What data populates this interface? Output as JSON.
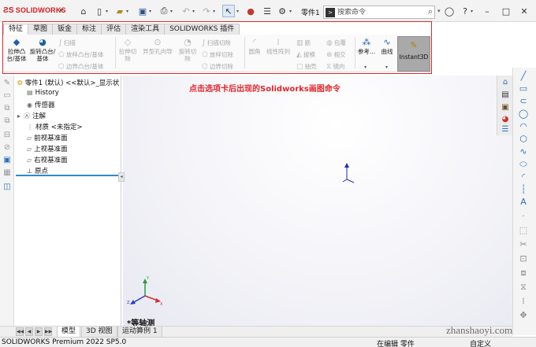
{
  "titlebar": {
    "logo_ds": "ƧS",
    "logo_text": "SOLIDWORKS",
    "part_name": "零件1",
    "search": {
      "term_icon": ">",
      "placeholder": "搜索命令"
    }
  },
  "tabs": [
    {
      "label": "特征",
      "active": true
    },
    {
      "label": "草图"
    },
    {
      "label": "钣金"
    },
    {
      "label": "标注"
    },
    {
      "label": "评估"
    },
    {
      "label": "渲染工具"
    },
    {
      "label": "SOLIDWORKS 插件"
    }
  ],
  "commands": {
    "extrude_boss": "拉伸凸台/基体",
    "revolve_boss": "旋转凸台/基体",
    "sweep": "扫描",
    "loft_boss": "放样凸台/基体",
    "boundary_boss": "边界凸台/基体",
    "extrude_cut": "拉伸切除",
    "hole_wizard": "异型孔向导",
    "revolve_cut": "旋转切除",
    "swept_cut": "扫描切除",
    "lofted_cut": "放样切除",
    "boundary_cut": "边界切除",
    "fillet": "圆角",
    "linear_pattern": "线性阵列",
    "rib": "筋",
    "draft": "拔模",
    "shell": "抽壳",
    "wrap": "包覆",
    "intersect": "相交",
    "mirror": "镜向",
    "reference": "参考...",
    "curves": "曲线",
    "instant3d": "Instant3D"
  },
  "tree": {
    "root": "零件1 (默认) <<默认>_显示状",
    "items": [
      "History",
      "传感器",
      "注解",
      "材质 <未指定>",
      "前视基准面",
      "上视基准面",
      "右视基准面",
      "原点"
    ]
  },
  "annotation": "点击选项卡后出现的Solidworks画图命令",
  "view_label": "*等轴测",
  "bottom_tabs": [
    {
      "label": "模型",
      "active": true
    },
    {
      "label": "3D 视图"
    },
    {
      "label": "运动算例 1"
    }
  ],
  "status": {
    "app": "SOLIDWORKS Premium 2022 SP5.0",
    "mode": "在编辑 零件",
    "custom": "自定义"
  },
  "watermark": "zhanshaoyi.com",
  "colors": {
    "annotation": "#e0262b",
    "accent_blue": "#2c8ad1",
    "logo_red": "#d71920"
  }
}
